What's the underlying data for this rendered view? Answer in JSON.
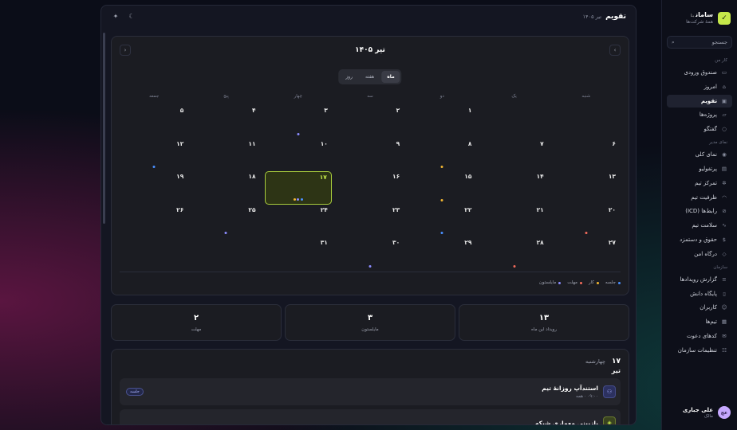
{
  "brand": {
    "name": "سامان",
    "badge": "بتا",
    "subtitle": "همهٔ شرکت‌ها"
  },
  "search": {
    "label": "جستجو"
  },
  "sidebar": {
    "sections": [
      {
        "title": "کار من",
        "items": [
          {
            "label": "صندوق ورودی",
            "icon": "inbox-icon",
            "glyph": "▭"
          },
          {
            "label": "امروز",
            "icon": "home-icon",
            "glyph": "⌂"
          },
          {
            "label": "تقویم",
            "icon": "calendar-icon",
            "glyph": "▣",
            "active": true
          },
          {
            "label": "پروژه‌ها",
            "icon": "folder-icon",
            "glyph": "▱"
          },
          {
            "label": "گفتگو",
            "icon": "chat-icon",
            "glyph": "○"
          }
        ]
      },
      {
        "title": "نمای مدیر",
        "items": [
          {
            "label": "نمای کلی",
            "icon": "eye-icon",
            "glyph": "◉"
          },
          {
            "label": "پرتفولیو",
            "icon": "briefcase-icon",
            "glyph": "▤"
          },
          {
            "label": "تمرکز تیم",
            "icon": "gear-icon",
            "glyph": "✲"
          },
          {
            "label": "ظرفیت تیم",
            "icon": "gauge-icon",
            "glyph": "◠"
          },
          {
            "label": "رابط‌ها (ICD)",
            "icon": "link-icon",
            "glyph": "⊘"
          },
          {
            "label": "سلامت تیم",
            "icon": "pulse-icon",
            "glyph": "∿"
          },
          {
            "label": "حقوق و دستمزد",
            "icon": "dollar-icon",
            "glyph": "$"
          },
          {
            "label": "درگاه امن",
            "icon": "shield-icon",
            "glyph": "◇"
          }
        ]
      },
      {
        "title": "سازمان",
        "items": [
          {
            "label": "گزارش رویدادها",
            "icon": "list-icon",
            "glyph": "≡"
          },
          {
            "label": "پایگاه دانش",
            "icon": "book-icon",
            "glyph": "▯"
          },
          {
            "label": "کاربران",
            "icon": "users-icon",
            "glyph": "☺"
          },
          {
            "label": "تیم‌ها",
            "icon": "grid-icon",
            "glyph": "▦"
          },
          {
            "label": "کدهای دعوت",
            "icon": "mail-icon",
            "glyph": "✉"
          },
          {
            "label": "تنظیمات سازمان",
            "icon": "settings-icon",
            "glyph": "☷"
          }
        ]
      }
    ]
  },
  "user": {
    "initials": "عج",
    "name": "علی جباری",
    "role": "مالک"
  },
  "header": {
    "title": "تقویم",
    "subtitle": "تیر ۱۴۰۵"
  },
  "calendar": {
    "month_label": "تیر ۱۴۰۵",
    "views": [
      {
        "label": "ماه",
        "on": true
      },
      {
        "label": "هفته"
      },
      {
        "label": "روز"
      }
    ],
    "weekdays": [
      "شنبه",
      "یک",
      "دو",
      "سه",
      "چهار",
      "پنج",
      "جمعه"
    ],
    "days": [
      {
        "n": "",
        "dots": []
      },
      {
        "n": "",
        "dots": []
      },
      {
        "n": "۱",
        "dots": []
      },
      {
        "n": "۲",
        "dots": []
      },
      {
        "n": "۳",
        "dots": [
          "#8b8cff"
        ]
      },
      {
        "n": "۴",
        "dots": []
      },
      {
        "n": "۵",
        "dots": []
      },
      {
        "n": "۶",
        "dots": []
      },
      {
        "n": "۷",
        "dots": []
      },
      {
        "n": "۸",
        "dots": [
          "#f2b632"
        ]
      },
      {
        "n": "۹",
        "dots": []
      },
      {
        "n": "۱۰",
        "dots": []
      },
      {
        "n": "۱۱",
        "dots": []
      },
      {
        "n": "۱۲",
        "dots": [
          "#4a90ff"
        ]
      },
      {
        "n": "۱۳",
        "dots": []
      },
      {
        "n": "۱۴",
        "dots": []
      },
      {
        "n": "۱۵",
        "dots": [
          "#f2b632"
        ]
      },
      {
        "n": "۱۶",
        "dots": []
      },
      {
        "n": "۱۷",
        "today": true,
        "dots": [
          "#4a90ff",
          "#8b8cff",
          "#f2b632"
        ]
      },
      {
        "n": "۱۸",
        "dots": []
      },
      {
        "n": "۱۹",
        "dots": []
      },
      {
        "n": "۲۰",
        "dots": [
          "#f26b5b"
        ]
      },
      {
        "n": "۲۱",
        "dots": []
      },
      {
        "n": "۲۲",
        "dots": [
          "#4a90ff"
        ]
      },
      {
        "n": "۲۳",
        "dots": []
      },
      {
        "n": "۲۴",
        "dots": []
      },
      {
        "n": "۲۵",
        "dots": [
          "#8b8cff"
        ]
      },
      {
        "n": "۲۶",
        "dots": []
      },
      {
        "n": "۲۷",
        "dots": []
      },
      {
        "n": "۲۸",
        "dots": [
          "#f26b5b"
        ]
      },
      {
        "n": "۲۹",
        "dots": []
      },
      {
        "n": "۳۰",
        "dots": [
          "#8b8cff"
        ]
      },
      {
        "n": "۳۱",
        "dots": []
      },
      {
        "n": "",
        "dots": []
      },
      {
        "n": "",
        "dots": []
      }
    ],
    "legend": [
      {
        "label": "جلسه",
        "color": "#4a90ff"
      },
      {
        "label": "کار",
        "color": "#f2b632"
      },
      {
        "label": "مهلت",
        "color": "#f26b5b"
      },
      {
        "label": "مایلستون",
        "color": "#8b8cff"
      }
    ]
  },
  "stats": [
    {
      "value": "۱۳",
      "label": "رویداد این ماه"
    },
    {
      "value": "۳",
      "label": "مایلستون"
    },
    {
      "value": "۲",
      "label": "مهلت"
    }
  ],
  "day_detail": {
    "day_number": "۱۷",
    "day_name": "چهارشنبه",
    "month": "تیر",
    "events": [
      {
        "title": "استندآپ روزانهٔ تیم",
        "meta": "۰۹:۰۰ · همه",
        "badge": "جلسه",
        "icon": "meeting-icon",
        "glyph": "⚇",
        "tone": "blue"
      },
      {
        "title": "بازبینی معماری شبکه",
        "meta": "",
        "badge": "",
        "icon": "review-icon",
        "glyph": "◈",
        "tone": "green"
      }
    ]
  },
  "colors": {
    "accent": "#c5e84a",
    "today_border": "#a8cc3c"
  }
}
